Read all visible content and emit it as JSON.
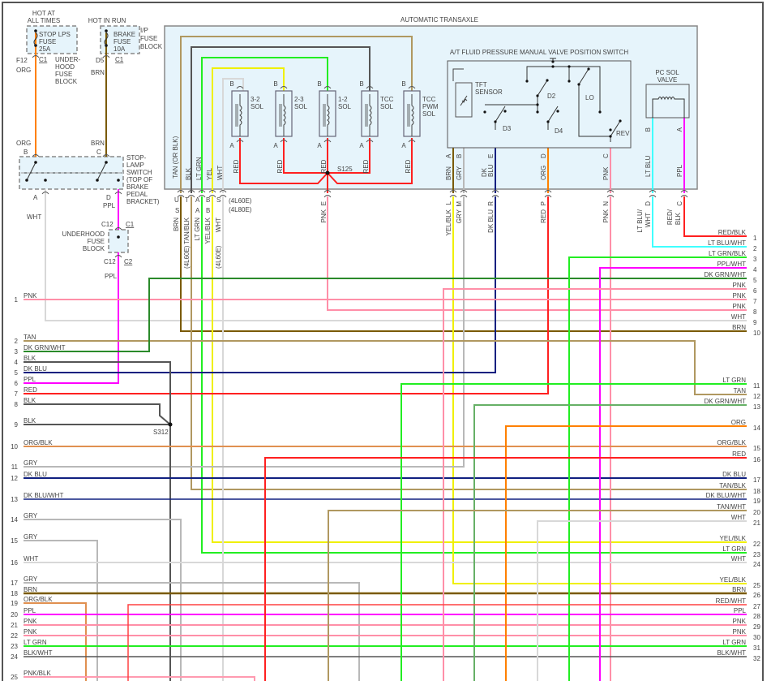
{
  "title": "AUTOMATIC TRANSAXLE",
  "colors": {
    "ORG": "#ff8000",
    "BRN": "#7a5a00",
    "TAN": "#b09860",
    "BLK": "#555555",
    "LTGRN": "#22ee22",
    "YEL": "#f0f000",
    "WHT": "#d8d8d8",
    "RED": "#ff2020",
    "PNK": "#ff8fa8",
    "PPL": "#ff00ff",
    "DKBLU": "#102080",
    "GRY": "#b8b8b8",
    "DKGRNWHT": "#2a8a2a",
    "DKGRN2": "#66b066",
    "LTBLU": "#40ffff",
    "ORGBLK": "#e09050",
    "REDWHT": "#ff4040",
    "PNKBLK": "#ff9ab0",
    "box": "#e6f4fb",
    "frame": "#555555"
  },
  "power": {
    "hot_all": [
      "HOT AT",
      "ALL TIMES"
    ],
    "fuse1": [
      "STOP LPS",
      "FUSE",
      "25A"
    ],
    "fuse1_block": [
      "UNDER-",
      "HOOD",
      "FUSE",
      "BLOCK"
    ],
    "hot_run": "HOT IN RUN",
    "fuse2": [
      "BRAKE",
      "FUSE",
      "10A"
    ],
    "fuse2_block": [
      "I/P",
      "FUSE",
      "BLOCK"
    ],
    "f12": "F12",
    "c1a": "C1",
    "org1": "ORG",
    "d5": "D5",
    "c1b": "C1",
    "brn1": "BRN",
    "org2": "ORG",
    "pinB": "B",
    "brn2": "BRN",
    "pinC": "C",
    "switch_name": [
      "STOP-",
      "LAMP",
      "SWITCH",
      "(TOP OF",
      "BRAKE",
      "PEDAL",
      "BRACKET)"
    ],
    "pinA": "A",
    "wht": "WHT",
    "pinD": "D",
    "ppl1": "PPL",
    "c12a": "C12",
    "c1c": "C1",
    "uh_block": [
      "UNDERHOOD",
      "FUSE",
      "BLOCK"
    ],
    "c12b": "C12",
    "c2": "C2",
    "ppl2": "PPL"
  },
  "transaxle": {
    "inside_wires": [
      "TAN (OR BLK)",
      "BLK",
      "LT GRN",
      "YEL",
      "WHT"
    ],
    "pins_row1": [
      "U",
      "T",
      "A",
      "B",
      "S"
    ],
    "pins_row2": [
      "S",
      "A",
      "B"
    ],
    "outside_wires": [
      "BRN",
      "TAN/BLK",
      "LT GRN",
      "YEL/BLK",
      "WHT"
    ],
    "variant_a": "(4L60E)",
    "variant_b": "(4L80E)",
    "variant_c": "(4L60E)",
    "variant_d": "(4L60E)",
    "solenoids": [
      {
        "name": [
          "3-2",
          "SOL"
        ]
      },
      {
        "name": [
          "2-3",
          "SOL"
        ]
      },
      {
        "name": [
          "1-2",
          "SOL"
        ]
      },
      {
        "name": [
          "TCC",
          "SOL"
        ]
      },
      {
        "name": [
          "TCC",
          "PWM",
          "SOL"
        ]
      }
    ],
    "sol_pin_b": "B",
    "sol_pin_a": "A",
    "sol_wire": "RED",
    "splice": "S125",
    "pin_e": "E",
    "pnk": "PNK"
  },
  "switch": {
    "title": "A/T FLUID PRESSURE MANUAL VALVE POSITION SWITCH",
    "tft": [
      "TFT",
      "SENSOR"
    ],
    "positions": [
      "D2",
      "D3",
      "D4",
      "LO",
      "REV"
    ],
    "inner_pins": [
      "A",
      "B",
      "E",
      "D",
      "C"
    ],
    "inner_wires": [
      "BRN",
      "GRY",
      "DK",
      "BLU",
      "ORG",
      "PNK"
    ],
    "outer_pins": [
      "L",
      "M",
      "R",
      "P",
      "N"
    ],
    "outer_wires": [
      "YEL/BLK",
      "GRY",
      "DK BLU",
      "RED",
      "PNK"
    ]
  },
  "pc_sol": {
    "name": [
      "PC SOL",
      "VALVE"
    ],
    "inner_pins": [
      "B",
      "A"
    ],
    "inner_wires": [
      "LT BLU",
      "PPL"
    ],
    "outer_pins": [
      "D",
      "C"
    ],
    "outer_wires": [
      "LT BLU/",
      "WHT",
      "RED/",
      "BLK"
    ]
  },
  "splice_s312": "S312",
  "left_rows": [
    {
      "n": "1",
      "label": "PNK"
    },
    {
      "n": "2",
      "label": "TAN"
    },
    {
      "n": "3",
      "label": "DK GRN/WHT"
    },
    {
      "n": "4",
      "label": "BLK"
    },
    {
      "n": "5",
      "label": "DK BLU"
    },
    {
      "n": "6",
      "label": "PPL"
    },
    {
      "n": "7",
      "label": "RED"
    },
    {
      "n": "8",
      "label": "BLK"
    },
    {
      "n": "9",
      "label": "BLK"
    },
    {
      "n": "10",
      "label": "ORG/BLK"
    },
    {
      "n": "11",
      "label": "GRY"
    },
    {
      "n": "12",
      "label": "DK BLU"
    },
    {
      "n": "13",
      "label": "DK BLU/WHT"
    },
    {
      "n": "14",
      "label": "GRY"
    },
    {
      "n": "15",
      "label": "GRY"
    },
    {
      "n": "16",
      "label": "WHT"
    },
    {
      "n": "17",
      "label": "GRY"
    },
    {
      "n": "18",
      "label": "BRN"
    },
    {
      "n": "19",
      "label": "ORG/BLK"
    },
    {
      "n": "20",
      "label": "PPL"
    },
    {
      "n": "21",
      "label": "PNK"
    },
    {
      "n": "22",
      "label": "PNK"
    },
    {
      "n": "23",
      "label": "LT GRN"
    },
    {
      "n": "24",
      "label": "BLK/WHT"
    },
    {
      "n": "25",
      "label": "PNK/BLK"
    }
  ],
  "right_rows": [
    {
      "n": "1",
      "label": "RED/BLK"
    },
    {
      "n": "2",
      "label": "LT BLU/WHT"
    },
    {
      "n": "3",
      "label": "LT GRN/BLK"
    },
    {
      "n": "4",
      "label": "PPL/WHT"
    },
    {
      "n": "5",
      "label": "DK GRN/WHT"
    },
    {
      "n": "6",
      "label": "PNK"
    },
    {
      "n": "7",
      "label": "PNK"
    },
    {
      "n": "8",
      "label": "PNK"
    },
    {
      "n": "9",
      "label": "WHT"
    },
    {
      "n": "10",
      "label": "BRN"
    },
    {
      "n": "11",
      "label": "LT GRN"
    },
    {
      "n": "12",
      "label": "TAN"
    },
    {
      "n": "13",
      "label": "DK GRN/WHT"
    },
    {
      "n": "14",
      "label": "ORG"
    },
    {
      "n": "15",
      "label": "ORG/BLK"
    },
    {
      "n": "16",
      "label": "RED"
    },
    {
      "n": "17",
      "label": "DK BLU"
    },
    {
      "n": "18",
      "label": "TAN/BLK"
    },
    {
      "n": "19",
      "label": "DK BLU/WHT"
    },
    {
      "n": "20",
      "label": "TAN/WHT"
    },
    {
      "n": "21",
      "label": "WHT"
    },
    {
      "n": "22",
      "label": "YEL/BLK"
    },
    {
      "n": "23",
      "label": "LT GRN"
    },
    {
      "n": "24",
      "label": "WHT"
    },
    {
      "n": "25",
      "label": "YEL/BLK"
    },
    {
      "n": "26",
      "label": "BRN"
    },
    {
      "n": "27",
      "label": "RED/WHT"
    },
    {
      "n": "28",
      "label": "PPL"
    },
    {
      "n": "29",
      "label": "PNK"
    },
    {
      "n": "30",
      "label": "PNK"
    },
    {
      "n": "31",
      "label": "LT GRN"
    },
    {
      "n": "32",
      "label": "BLK/WHT"
    }
  ]
}
